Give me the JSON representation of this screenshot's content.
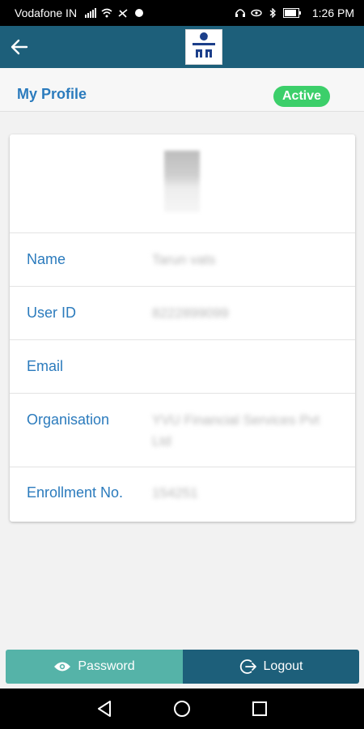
{
  "status_bar": {
    "carrier": "Vodafone IN",
    "time": "1:26 PM"
  },
  "app_bar": {
    "color": "#1d5f7a"
  },
  "profile": {
    "title": "My Profile",
    "status": "Active"
  },
  "details": [
    {
      "label": "Name",
      "value": "Tarun vats"
    },
    {
      "label": "User ID",
      "value": "8222899099"
    },
    {
      "label": "Email",
      "value": ""
    },
    {
      "label": "Organisation",
      "value": "YVU Financial Services Pvt Ltd"
    },
    {
      "label": "Enrollment No.",
      "value": "154251"
    }
  ],
  "actions": {
    "password_label": "Password",
    "logout_label": "Logout"
  },
  "colors": {
    "accent": "#2b7bbd",
    "active_badge": "#3ccf6a",
    "password_button": "#55b3a8",
    "logout_button": "#1d5f7a"
  }
}
